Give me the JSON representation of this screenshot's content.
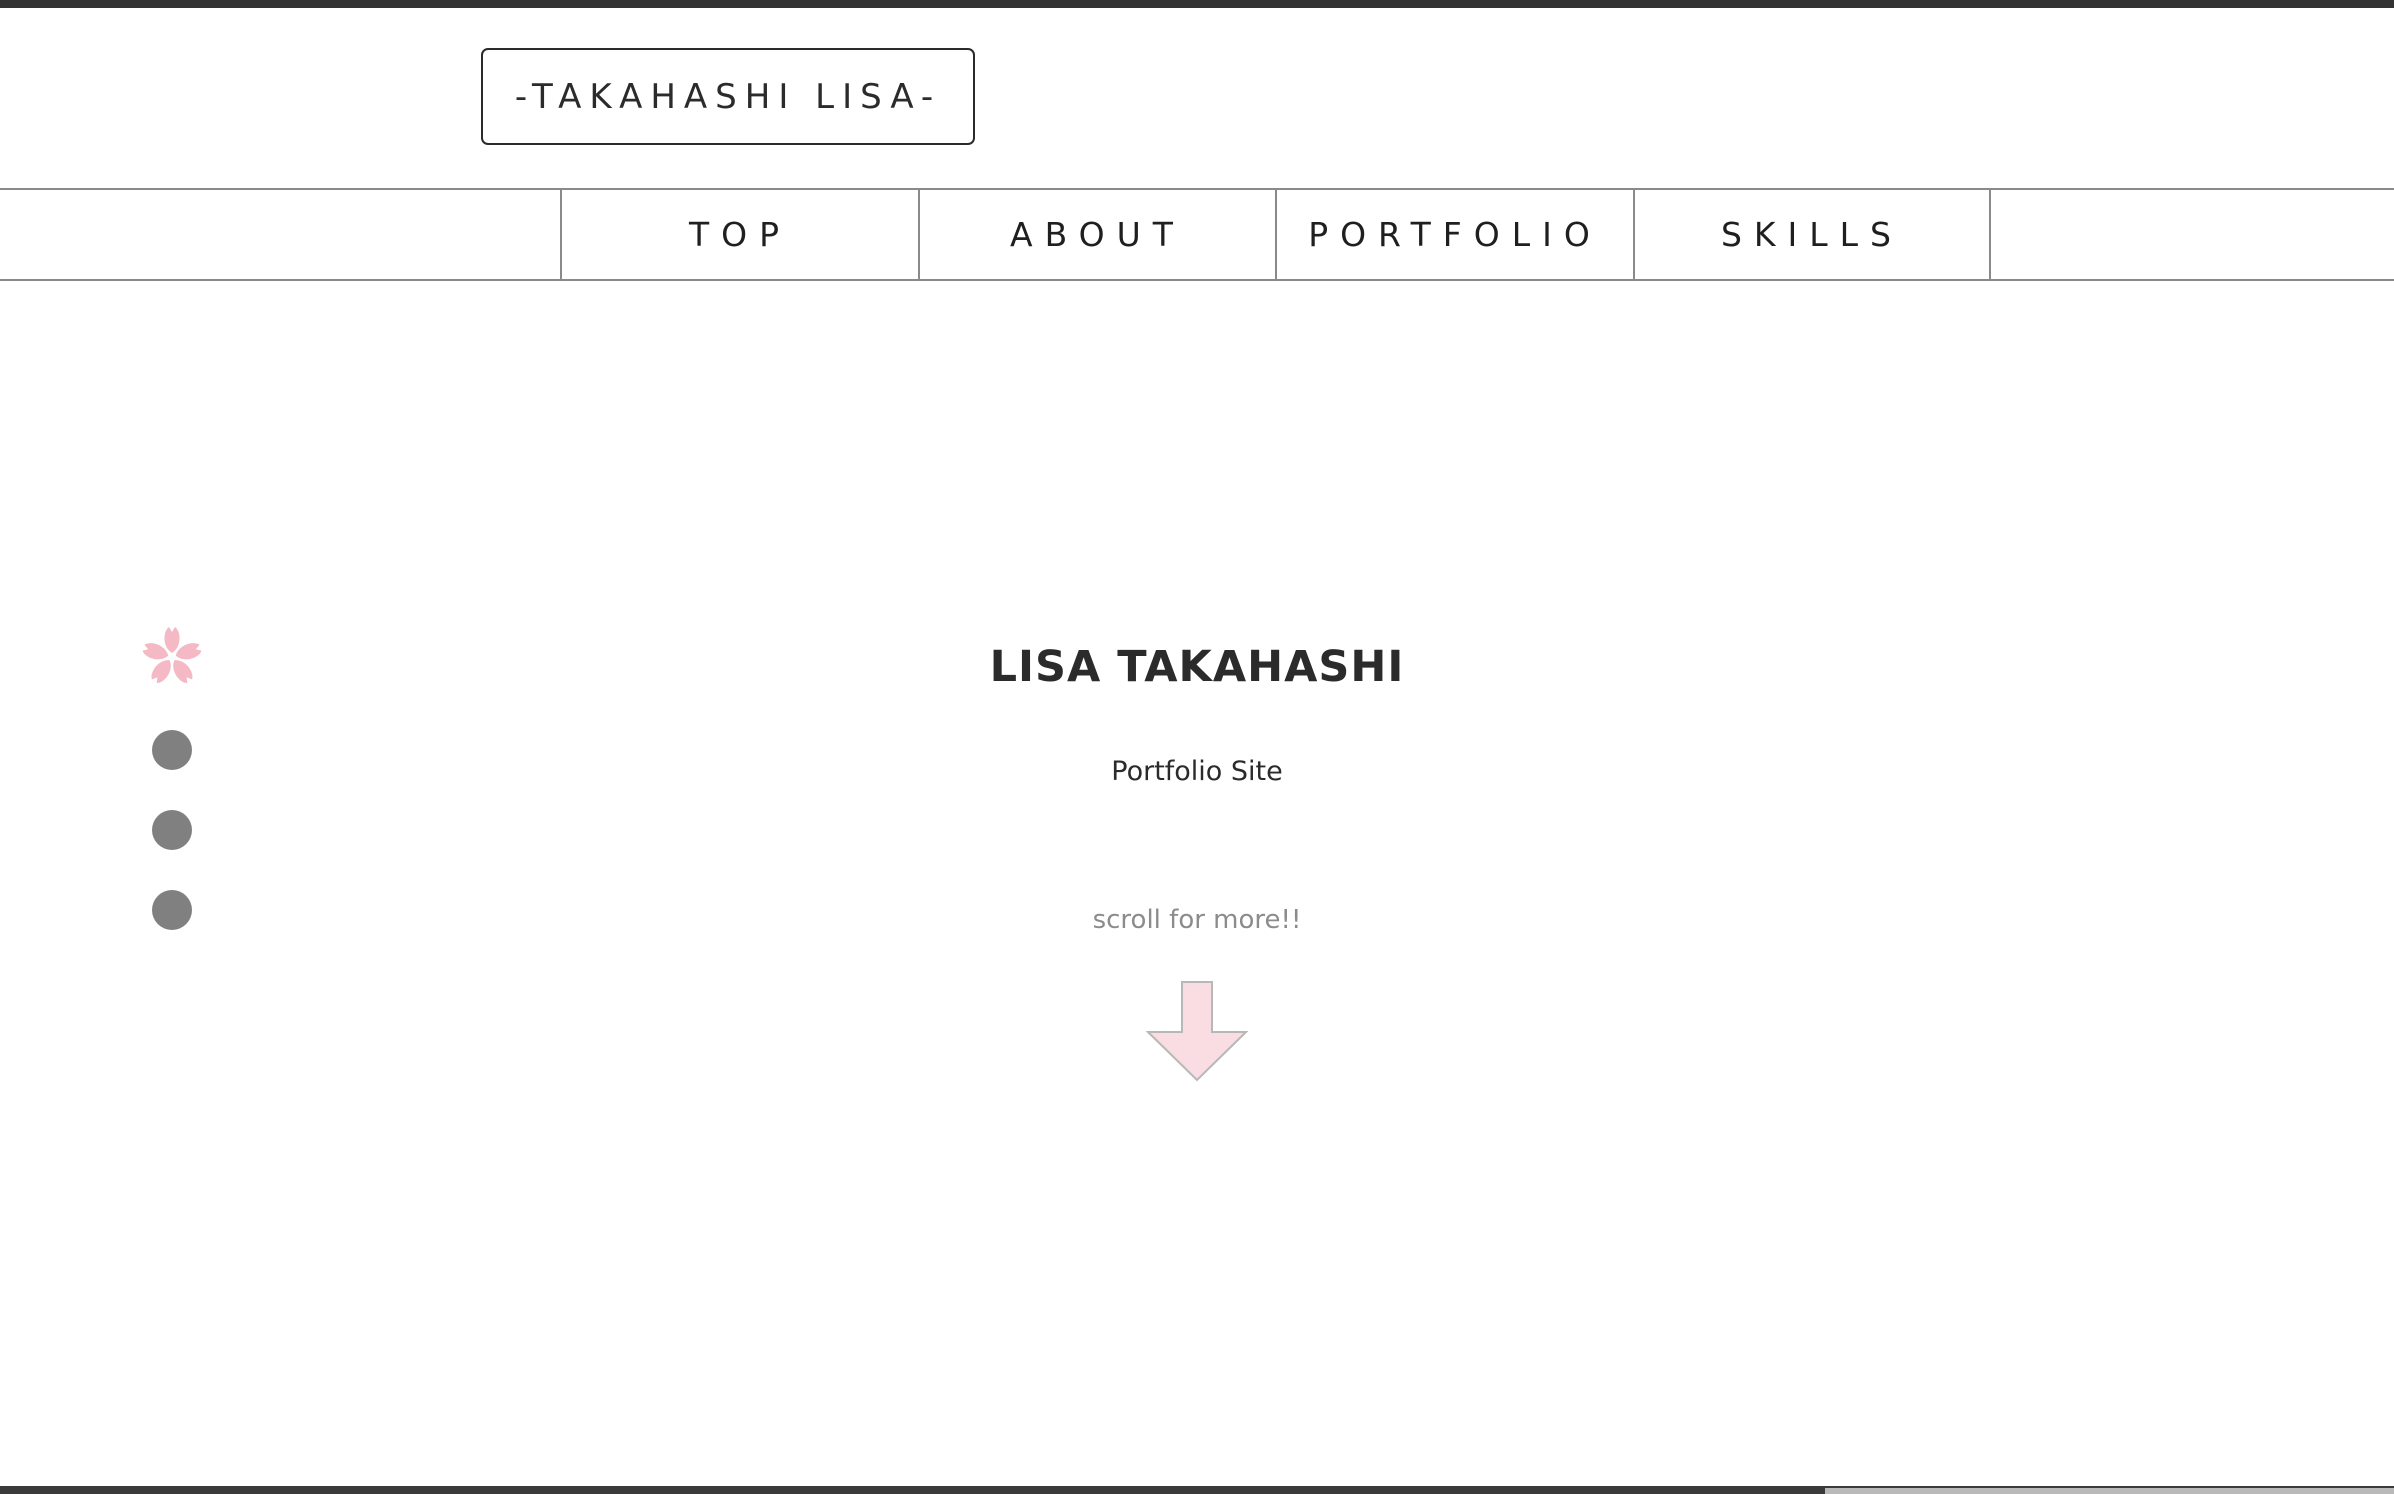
{
  "header": {
    "logo_text": "-TAKAHASHI LISA-"
  },
  "nav": {
    "items": [
      {
        "label": "TOP"
      },
      {
        "label": "ABOUT"
      },
      {
        "label": "PORTFOLIO"
      },
      {
        "label": "SKILLS"
      }
    ]
  },
  "side_nav": {
    "active_icon": "sakura-icon",
    "dot_count": 3
  },
  "hero": {
    "title": "LISA TAKAHASHI",
    "subtitle": "Portfolio Site",
    "scroll_hint": "scroll for more!!",
    "arrow_icon": "down-arrow-icon"
  },
  "colors": {
    "accent_pink": "#f9dde2",
    "sakura_pink": "#f4b9c5",
    "dot_gray": "#808080",
    "border_gray": "#8a8a8a",
    "text_dark": "#2b2b2b"
  }
}
